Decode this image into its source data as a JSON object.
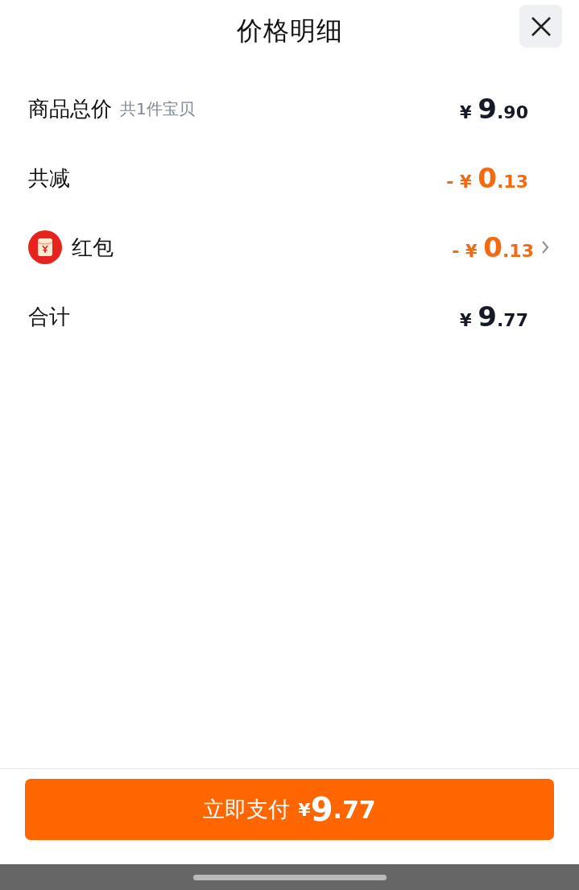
{
  "title": "价格明细",
  "rows": [
    {
      "kind": "plain",
      "label": "商品总价",
      "note": "共1件宝贝",
      "discount": false,
      "sign": "",
      "currency": "¥",
      "integer": "9",
      "decimal": ".90"
    },
    {
      "kind": "plain",
      "label": "共减",
      "discount": true,
      "sign": "-",
      "currency": "¥",
      "integer": "0",
      "decimal": ".13"
    },
    {
      "kind": "coupon",
      "label": "红包",
      "discount": true,
      "sign": "-",
      "currency": "¥",
      "integer": "0",
      "decimal": ".13"
    },
    {
      "kind": "plain",
      "label": "合计",
      "discount": false,
      "sign": "",
      "currency": "¥",
      "integer": "9",
      "decimal": ".77"
    }
  ],
  "pay_button": {
    "label": "立即支付",
    "currency": "¥",
    "integer": "9",
    "decimal": ".77"
  }
}
